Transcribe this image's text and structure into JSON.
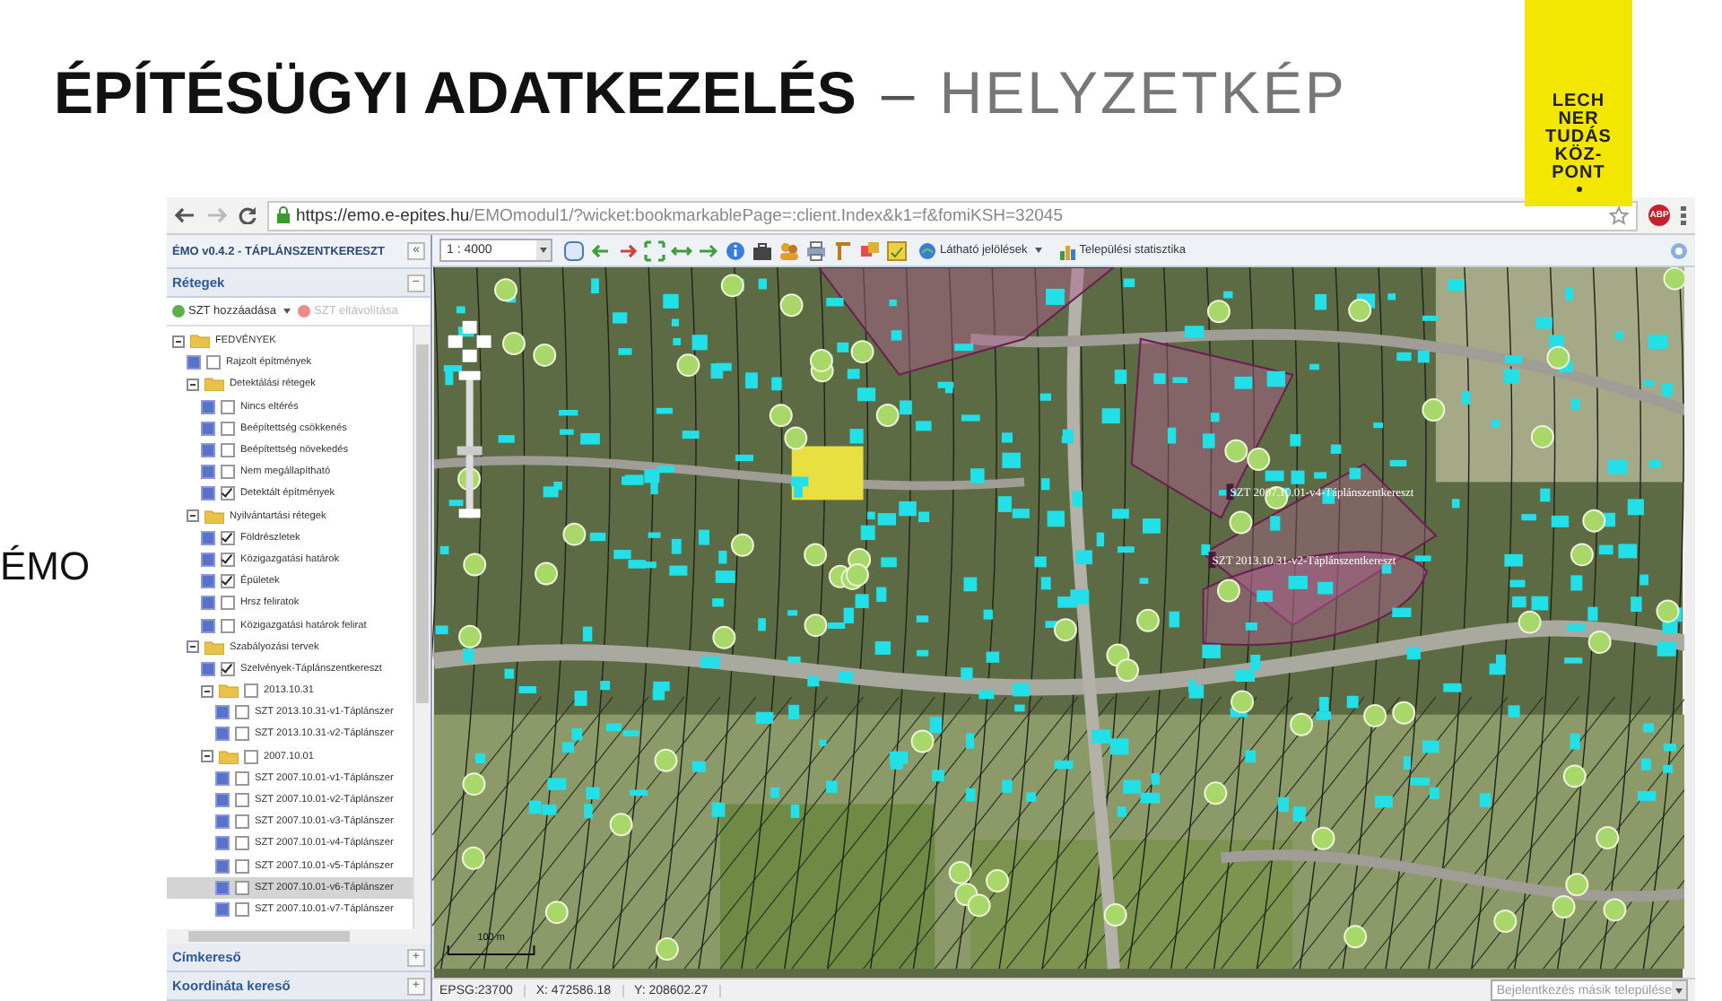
{
  "slide": {
    "title_main": "ÉPÍTÉSÜGYI ADATKEZELÉS",
    "title_dash": "–",
    "title_sub": "HELYZETKÉP",
    "side_text": "ÉMO",
    "logo_lines": [
      "LECH",
      "NER",
      "TUDÁS",
      "KÖZ-",
      "PONT"
    ]
  },
  "browser": {
    "url_host": "https://emo.e-epites.hu",
    "url_path": "/EMOmodul1/?wicket:bookmarkablePage=:client.Index&k1=f&fomiKSH=32045",
    "adblock_label": "ABP"
  },
  "panel": {
    "title": "ÉMO v0.4.2 - TÁPLÁNSZENTKERESZT",
    "collapse_label": "«",
    "layers_title": "Rétegek",
    "layers_toggle": "−",
    "tools": [
      {
        "label": "SZT hozzáadása",
        "disabled": false,
        "dropdown": true
      },
      {
        "label": "SZT eltávolítása",
        "disabled": true,
        "dropdown": false
      }
    ],
    "tree": [
      {
        "label": "FEDVÉNYEK",
        "kind": "folder",
        "expanded": true,
        "selected": false,
        "children": [
          {
            "label": "Rajzolt építmények",
            "kind": "layer",
            "checked": false,
            "selected": false
          },
          {
            "label": "Detektálási rétegek",
            "kind": "folder",
            "expanded": true,
            "selected": false,
            "children": [
              {
                "label": "Nincs eltérés",
                "kind": "layer",
                "checked": false,
                "selected": false
              },
              {
                "label": "Beépítettség csökkenés",
                "kind": "layer",
                "checked": false,
                "selected": false
              },
              {
                "label": "Beépítettség növekedés",
                "kind": "layer",
                "checked": false,
                "selected": false
              },
              {
                "label": "Nem megállapítható",
                "kind": "layer",
                "checked": false,
                "selected": false
              },
              {
                "label": "Detektált építmények",
                "kind": "layer",
                "checked": true,
                "selected": false
              }
            ]
          },
          {
            "label": "Nyilvántartási rétegek",
            "kind": "folder",
            "expanded": true,
            "selected": false,
            "children": [
              {
                "label": "Földrészletek",
                "kind": "layer",
                "checked": true,
                "selected": false
              },
              {
                "label": "Közigazgatási határok",
                "kind": "layer",
                "checked": true,
                "selected": false
              },
              {
                "label": "Épületek",
                "kind": "layer",
                "checked": true,
                "selected": false
              },
              {
                "label": "Hrsz feliratok",
                "kind": "layer",
                "checked": false,
                "selected": false
              },
              {
                "label": "Közigazgatási határok felirat",
                "kind": "layer",
                "checked": false,
                "selected": false
              }
            ]
          },
          {
            "label": "Szabályozási tervek",
            "kind": "folder",
            "expanded": true,
            "selected": false,
            "children": [
              {
                "label": "Szelvények-Táplánszentkereszt",
                "kind": "layer",
                "checked": true,
                "selected": false
              },
              {
                "label": "2013.10.31",
                "kind": "folder",
                "expanded": true,
                "checked": false,
                "selected": false,
                "children": [
                  {
                    "label": "SZT 2013.10.31-v1-Táplánszer",
                    "kind": "layer",
                    "checked": false,
                    "selected": false
                  },
                  {
                    "label": "SZT 2013.10.31-v2-Táplánszer",
                    "kind": "layer",
                    "checked": false,
                    "selected": false
                  }
                ]
              },
              {
                "label": "2007.10.01",
                "kind": "folder",
                "expanded": true,
                "checked": false,
                "selected": false,
                "children": [
                  {
                    "label": "SZT 2007.10.01-v1-Táplánszer",
                    "kind": "layer",
                    "checked": false,
                    "selected": false
                  },
                  {
                    "label": "SZT 2007.10.01-v2-Táplánszer",
                    "kind": "layer",
                    "checked": false,
                    "selected": false
                  },
                  {
                    "label": "SZT 2007.10.01-v3-Táplánszer",
                    "kind": "layer",
                    "checked": false,
                    "selected": false
                  },
                  {
                    "label": "SZT 2007.10.01-v4-Táplánszer",
                    "kind": "layer",
                    "checked": false,
                    "selected": false
                  },
                  {
                    "label": "SZT 2007.10.01-v5-Táplánszer",
                    "kind": "layer",
                    "checked": false,
                    "selected": false
                  },
                  {
                    "label": "SZT 2007.10.01-v6-Táplánszer",
                    "kind": "layer",
                    "checked": false,
                    "selected": true
                  },
                  {
                    "label": "SZT 2007.10.01-v7-Táplánszer",
                    "kind": "layer",
                    "checked": false,
                    "selected": false
                  }
                ]
              }
            ]
          }
        ]
      }
    ],
    "sections": [
      {
        "label": "Címkereső",
        "toggle": "+"
      },
      {
        "label": "Koordináta kereső",
        "toggle": "+"
      }
    ]
  },
  "map": {
    "scale": "1 : 4000",
    "menus": [
      {
        "label": "Látható jelölések",
        "dropdown": true
      },
      {
        "label": "Települési statisztika",
        "dropdown": false
      }
    ],
    "labels": [
      {
        "text": "SZT 2007.10.01-v4-Táplánszentkereszt"
      },
      {
        "text": "SZT 2013.10.31-v2-Táplánszentkereszt"
      }
    ],
    "scale_bar": "100 m"
  },
  "status_bar": {
    "epsg": "EPSG:23700",
    "x": "X: 472586.18",
    "y": "Y: 208602.27",
    "login_select": "Bejelentkezés másik települése"
  }
}
